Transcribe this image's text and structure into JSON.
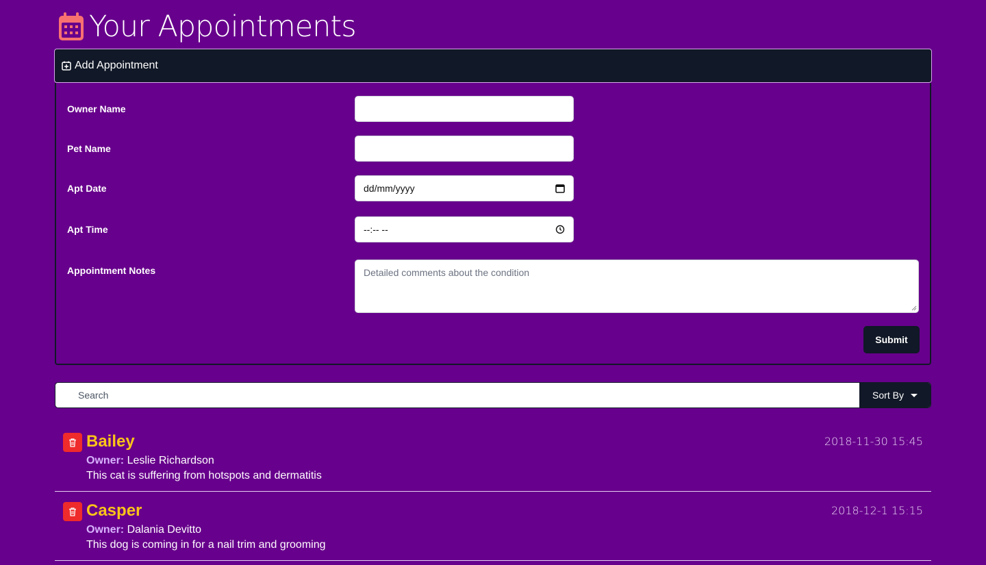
{
  "header": {
    "title": "Your Appointments",
    "icon": "calendar-icon",
    "icon_color": "#f87171"
  },
  "add_bar": {
    "label": "Add Appointment",
    "icon": "calendar-plus-icon"
  },
  "form": {
    "owner_label": "Owner Name",
    "pet_label": "Pet Name",
    "date_label": "Apt Date",
    "date_placeholder": "dd/mm/yyyy",
    "time_label": "Apt Time",
    "time_placeholder": "--:-- --",
    "notes_label": "Appointment Notes",
    "notes_placeholder": "Detailed comments about the condition",
    "submit_label": "Submit"
  },
  "search": {
    "placeholder": "Search",
    "sort_label": "Sort By"
  },
  "appointments": [
    {
      "pet": "Bailey",
      "owner_label": "Owner:",
      "owner": "Leslie Richardson",
      "notes": "This cat is suffering from hotspots and dermatitis",
      "date": "2018-11-30 15:45"
    },
    {
      "pet": "Casper",
      "owner_label": "Owner:",
      "owner": "Dalania Devitto",
      "notes": "This dog is coming in for a nail trim and grooming",
      "date": "2018-12-1 15:15"
    }
  ],
  "colors": {
    "background": "#67008c",
    "dark": "#111827",
    "pet_name": "#fcc419",
    "delete": "#ef2b2b"
  }
}
